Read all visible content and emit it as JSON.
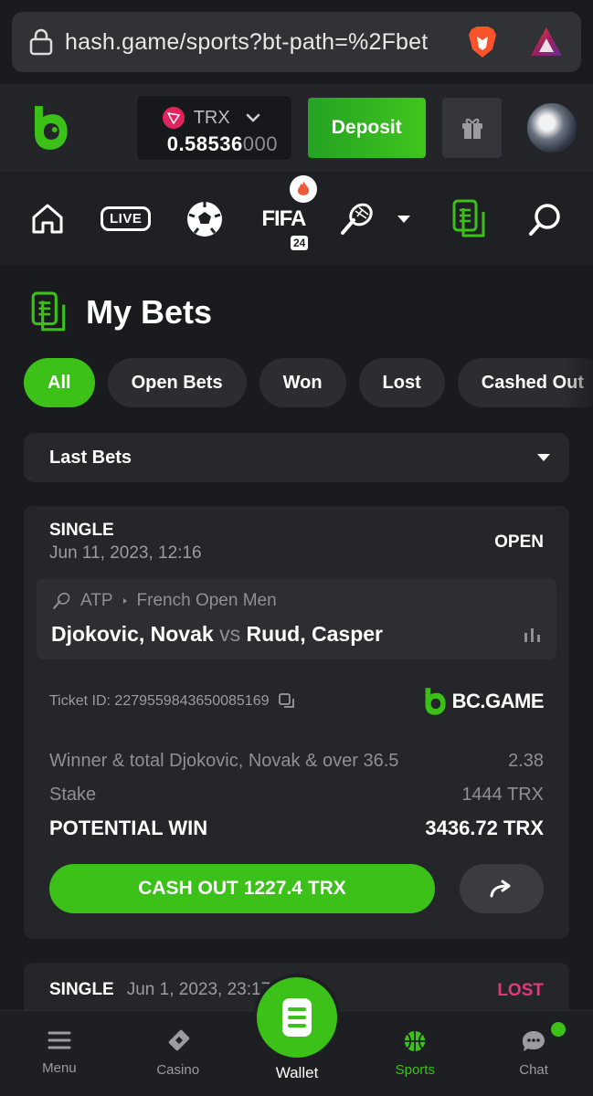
{
  "browser": {
    "url": "hash.game/sports?bt-path=%2Fbet"
  },
  "header": {
    "currency": "TRX",
    "balance_main": "0.58536",
    "balance_dim": "000",
    "deposit_label": "Deposit"
  },
  "sport_nav": {
    "live_label": "LIVE",
    "fifa_label": "FIFA",
    "fifa_year": "24"
  },
  "page": {
    "title": "My Bets"
  },
  "filters": [
    "All",
    "Open Bets",
    "Won",
    "Lost",
    "Cashed Out"
  ],
  "select": {
    "value": "Last Bets"
  },
  "bet": {
    "type": "SINGLE",
    "date": "Jun 11, 2023, 12:16",
    "status": "OPEN",
    "league": "ATP",
    "tournament": "French Open Men",
    "team1": "Djokovic, Novak",
    "vs": "vs",
    "team2": "Ruud, Casper",
    "ticket_label": "Ticket ID: 2279559843650085169",
    "brand": "BC.GAME",
    "market": "Winner & total Djokovic, Novak & over 36.5",
    "odds": "2.38",
    "stake_label": "Stake",
    "stake_value": "1444 TRX",
    "potential_label": "POTENTIAL WIN",
    "potential_value": "3436.72 TRX",
    "cashout_label": "CASH OUT 1227.4 TRX"
  },
  "bet2": {
    "type": "SINGLE",
    "date": "Jun 1, 2023, 23:17",
    "status": "LOST"
  },
  "bottom_nav": {
    "menu": "Menu",
    "casino": "Casino",
    "wallet": "Wallet",
    "sports": "Sports",
    "chat": "Chat"
  },
  "colors": {
    "accent": "#3bc117",
    "lost": "#e03a7a",
    "background": "#1a1b1e",
    "card": "#24262a"
  }
}
